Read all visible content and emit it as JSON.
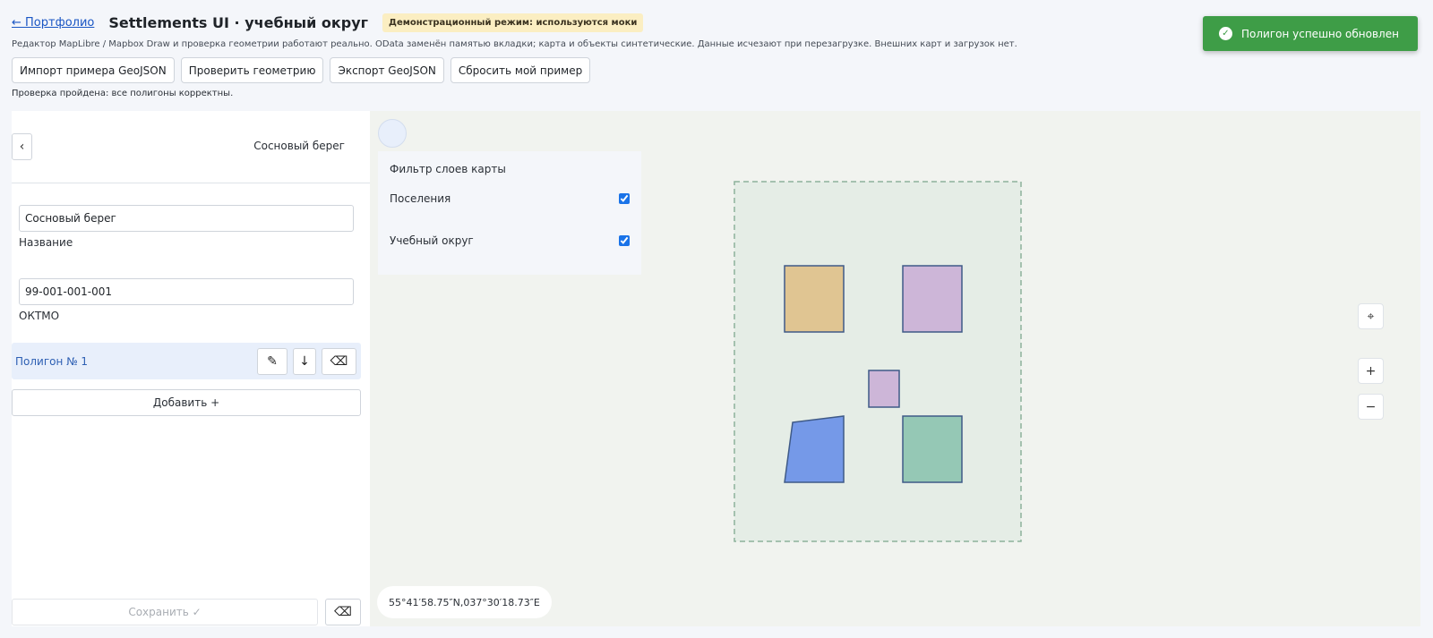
{
  "header": {
    "back_link": "← Портфолио",
    "title": "Settlements UI · учебный округ",
    "demo_badge": "Демонстрационный режим: используются моки",
    "subtitle": "Редактор MapLibre / Mapbox Draw и проверка геометрии работают реально. OData заменён памятью вкладки; карта и объекты синтетические. Данные исчезают при перезагрузке. Внешних карт и загрузок нет."
  },
  "toolbar": {
    "import_label": "Импорт примера GeoJSON",
    "validate_label": "Проверить геометрию",
    "export_label": "Экспорт GeoJSON",
    "reset_label": "Сбросить мой пример"
  },
  "status_line": "Проверка пройдена: все полигоны корректны.",
  "toast": {
    "icon": "check-circle-icon",
    "text": "Полигон успешно обновлен",
    "color": "#3e9d47"
  },
  "panel": {
    "collapse_icon": "‹",
    "title": "Сосновый берег",
    "name_value": "Сосновый берег",
    "name_label": "Название",
    "oktmo_value": "99-001-001-001",
    "oktmo_label": "ОКТМО",
    "polygon_name": "Полигон № 1",
    "edit_icon": "✎",
    "download_icon": "↓",
    "delete_icon": "⌫",
    "add_label": "Добавить +",
    "save_label": "Сохранить ✓",
    "bottom_delete_icon": "⌫"
  },
  "map": {
    "layer_filter_title": "Фильтр слоев карты",
    "layers": [
      {
        "label": "Поселения",
        "checked": true
      },
      {
        "label": "Учебный округ",
        "checked": true
      }
    ],
    "coords": "55°41′58.75″N,037°30′18.73″E",
    "controls": {
      "compass": "⌖",
      "zoom_in": "+",
      "zoom_out": "−"
    },
    "polygon_colors": [
      "#e0c592",
      "#cdb6d8",
      "#cdb6d8",
      "#7599e8",
      "#95c8b5"
    ],
    "polygon_stroke": "#3f5a87",
    "district_fill": "#e5ede6",
    "district_stroke": "#8db29c"
  }
}
